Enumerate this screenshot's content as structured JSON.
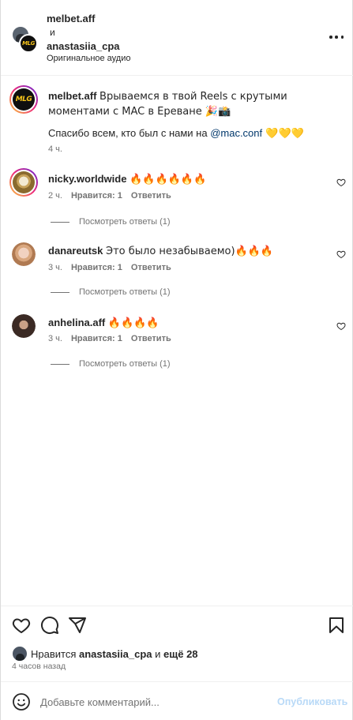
{
  "header": {
    "user1": "melbet.aff",
    "and": "и",
    "user2": "anastasiia_cpa",
    "audio": "Оригинальное аудио",
    "more_icon": "more-horizontal-icon"
  },
  "caption": {
    "avatar_text": "MLG",
    "username": "melbet.aff",
    "text": "Врываемся в твой Reels с крутыми моментами с MAC в Ереване 🎉📸",
    "line2_prefix": "Спасибо всем, кто был с нами на ",
    "mention": "@mac.conf",
    "line2_suffix": " 💛💛💛",
    "time": "4 ч."
  },
  "comments": [
    {
      "username": "nicky.worldwide",
      "text": "🔥🔥🔥🔥🔥🔥",
      "time": "2 ч.",
      "likes": "Нравится: 1",
      "reply": "Ответить",
      "view_replies": "Посмотреть ответы (1)"
    },
    {
      "username": "danareutsk",
      "text": "Это было незабываемо)🔥🔥🔥",
      "time": "3 ч.",
      "likes": "Нравится: 1",
      "reply": "Ответить",
      "view_replies": "Посмотреть ответы (1)"
    },
    {
      "username": "anhelina.aff",
      "text": "🔥🔥🔥🔥",
      "time": "3 ч.",
      "likes": "Нравится: 1",
      "reply": "Ответить",
      "view_replies": "Посмотреть ответы (1)"
    }
  ],
  "actions": {
    "like_icon": "heart-icon",
    "comment_icon": "comment-icon",
    "share_icon": "send-icon",
    "save_icon": "bookmark-icon"
  },
  "likes": {
    "prefix": "Нравится ",
    "user": "anastasiia_cpa",
    "middle": " и ",
    "others": "ещё 28"
  },
  "post_time": "4 часов назад",
  "add_comment": {
    "placeholder": "Добавьте комментарий...",
    "publish": "Опубликовать"
  },
  "colors": {
    "mention": "#00376b",
    "publish_disabled": "#b8d9f7",
    "meta": "#737373",
    "brand_yellow": "#f4c21a"
  }
}
